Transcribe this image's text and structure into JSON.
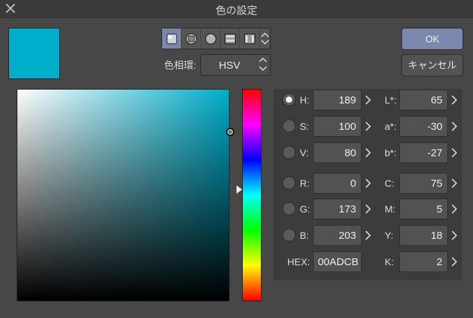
{
  "window": {
    "title": "色の設定",
    "close_icon": "close-icon"
  },
  "current_color": "#00adcb",
  "mode_icons": [
    "color-square-icon",
    "color-wheel-square-icon",
    "color-circle-icon",
    "color-sliders-icon",
    "color-palette-strip-icon"
  ],
  "color_ring": {
    "label": "色相環:",
    "value": "HSV"
  },
  "buttons": {
    "ok": "OK",
    "cancel": "キャンセル"
  },
  "hsv": {
    "hue_deg": 189,
    "saturation_pct": 100,
    "value_pct": 80
  },
  "fields_left": [
    {
      "label": "H:",
      "value": "189",
      "checked": true
    },
    {
      "label": "S:",
      "value": "100",
      "checked": false
    },
    {
      "label": "V:",
      "value": "80",
      "checked": false
    },
    {
      "label": "R:",
      "value": "0",
      "checked": false
    },
    {
      "label": "G:",
      "value": "173",
      "checked": false
    },
    {
      "label": "B:",
      "value": "203",
      "checked": false
    }
  ],
  "hex": {
    "label": "HEX:",
    "value": "00ADCB"
  },
  "fields_right": [
    {
      "label": "L*:",
      "value": "65"
    },
    {
      "label": "a*:",
      "value": "-30"
    },
    {
      "label": "b*:",
      "value": "-27"
    },
    {
      "label": "C:",
      "value": "75"
    },
    {
      "label": "M:",
      "value": "5"
    },
    {
      "label": "Y:",
      "value": "18"
    },
    {
      "label": "K:",
      "value": "2"
    }
  ]
}
